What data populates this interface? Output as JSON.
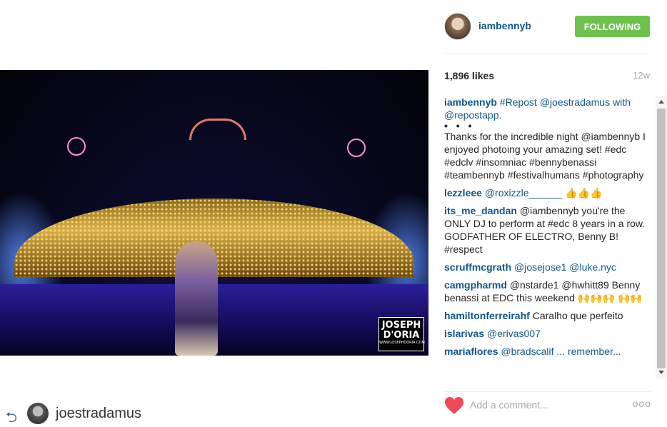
{
  "post": {
    "owner": "iambennyb",
    "follow_button": "FOLLOWING",
    "likes": "1,896 likes",
    "age": "12w",
    "photo_watermark": "JOSEPH D'ORIA",
    "photo_watermark_url": "WWW.JOSEPHDORIA.COM"
  },
  "comments": [
    {
      "user": "iambennyb",
      "text": "#Repost @joestradamus with @repostapp.",
      "all_link": true
    },
    {
      "user": "",
      "text": "Thanks for the incredible night @iambennyb I enjoyed photoing your amazing set! #edc #edclv #insomniac #bennybenassi #teambennyb #festivalhumans #photography",
      "all_link": false
    },
    {
      "user": "lezzleee",
      "text": "@roxizzle______ 👍👍👍"
    },
    {
      "user": "its_me_dandan",
      "text": "@iambennyb you're the ONLY DJ to perform at #edc 8 years in a row. GODFATHER OF ELECTRO, Benny B! #respect"
    },
    {
      "user": "scruffmcgrath",
      "text": "@josejose1 @luke.nyc"
    },
    {
      "user": "camgpharmd",
      "text": "@nstarde1 @hwhitt89 Benny benassi at EDC this weekend 🙌🙌🙌 🙌🙌"
    },
    {
      "user": "hamiltonferreirahf",
      "text": "Caralho que perfeito"
    },
    {
      "user": "islarivas",
      "text": "@erivas007"
    },
    {
      "user": "mariaflores",
      "text": "@bradscalif ... remember..."
    }
  ],
  "footer": {
    "comment_placeholder": "Add a comment...",
    "more_label": "ooo"
  },
  "repost": {
    "icon": "⮌",
    "username": "joestradamus"
  },
  "colors": {
    "link": "#125688",
    "follow_green": "#70c050",
    "heart_red": "#ed4956"
  }
}
